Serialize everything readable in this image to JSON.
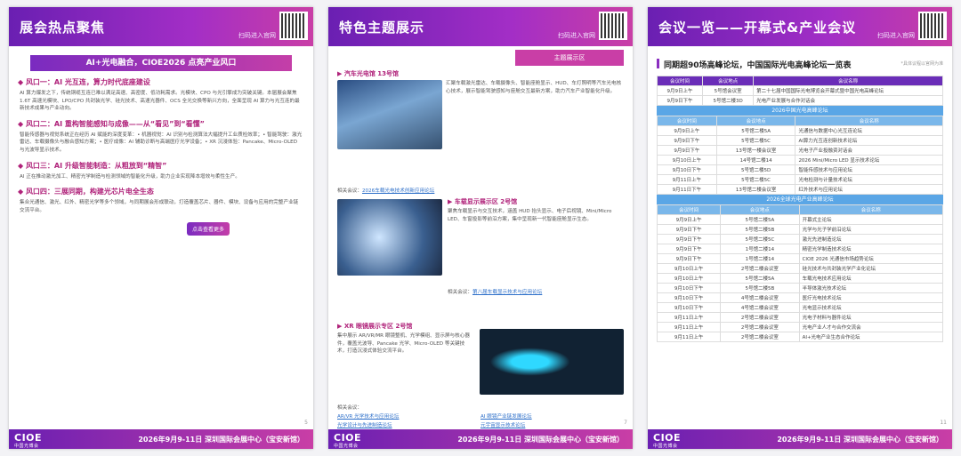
{
  "common": {
    "qr_label": "扫码进入官网",
    "logo": "CIOE",
    "logo_sub": "中国光博会",
    "footer": "2026年9月9-11日  深圳国际会展中心（宝安新馆）"
  },
  "page1": {
    "title": "展会热点聚焦",
    "banner": "AI+光电融合，CIOE2026 点亮产业风口",
    "sections": [
      {
        "title": "◆ 风口一：AI 光互连，算力时代底座建设",
        "text": "AI 算力爆发之下，传统铜缆互连已难以满足高速、高密度、低功耗需求。光模块、CPO 与光引擎成为突破关键。本届展会聚焦 1.6T 高速光模块、LPO/CPO 共封装光学、硅光技术、高速光器件、OCS 全光交换等新兴方向，全面呈现 AI 算力与光互连的最新技术成果与产业动向。"
      },
      {
        "title": "◆ 风口二：AI 重构智能感知与成像——从“看见”到“看懂”",
        "text": "智能传感器与视觉系统正在经历 AI 赋能的深度变革：• 机器视觉：AI 识别与检测算法大幅提升工业质检效率；• 智能驾驶：激光雷达、车载摄像头与融合感知方案；• 医疗成像：AI 辅助诊断与高端医疗光学设备；• XR 沉浸体验：Pancake、Micro-OLED 与光波导显示技术。"
      },
      {
        "title": "◆ 风口三：AI 升级智能制造：从粗放到“精智”",
        "text": "AI 正在推动激光加工、精密光学制造与检测领域的智能化升级，助力企业实现降本增效与柔性生产。"
      },
      {
        "title": "◆ 风口四：三展同期，构建光芯片电全生态",
        "text": "集合光通信、激光、红外、精密光学等多个领域，与同期展会形成联动，打造覆盖芯片、器件、模块、设备与应用的完整产业链交流平台。"
      }
    ],
    "button": "点击查看更多",
    "page_no": "5"
  },
  "page2": {
    "title": "特色主题展示",
    "tag": "主题展示区",
    "items": [
      {
        "title": "▶ 汽车光电馆 13号馆",
        "text": "汇聚车载激光雷达、车载摄像头、智能座舱显示、HUD、车灯照明等汽车光电核心技术，展示智能驾驶感知与座舱交互最新方案，助力汽车产业智能化升级。",
        "related": "相关会议：",
        "link": "2026车载光电技术创新应用论坛"
      },
      {
        "title": "▶ 车载显示展示区 2号馆",
        "text": "聚焦车载显示与交互技术，涵盖 HUD 抬头显示、电子后视镜、Mini/Micro LED、车窗投影等前沿方案，集中呈现新一代智能座舱显示生态。",
        "related": "相关会议：",
        "link": "第八届车载显示技术与应用论坛"
      },
      {
        "title": "▶ XR 眼镜展示专区 2号馆",
        "text": "集中展示 AR/VR/MR 眼镜整机、光学模组、显示屏与核心器件，覆盖光波导、Pancake 光学、Micro-OLED 等关键技术，打造沉浸式体验交流平台。",
        "related": "相关会议：",
        "links": [
          "AR/VR 光学技术与应用论坛",
          "AI 眼镜产业链发展论坛",
          "光学设计与先进制造论坛",
          "元宇宙显示技术论坛"
        ]
      }
    ],
    "page_no": "7"
  },
  "page3": {
    "title": "会议一览——开幕式&产业会议",
    "heading": "同期超90场高峰论坛，中国国际光电高峰论坛一览表",
    "note": "*具体议程以官网为准",
    "cols": [
      "会议时间",
      "会议地点",
      "会议名称"
    ],
    "opening": [
      [
        "9月9日上午",
        "5号馆会议室",
        "第二十七届中国国际光电博览会开幕式暨中国光电高峰论坛"
      ],
      [
        "9月9日下午",
        "5号馆二楼3D",
        "光电产业发展与合作对话会"
      ]
    ],
    "band1": "2026中国光电高峰论坛",
    "rows1": [
      [
        "9月9日上午",
        "5号馆二楼5A",
        "光通信与数据中心光互连论坛"
      ],
      [
        "9月9日下午",
        "5号馆二楼5C",
        "AI算力光互连创新技术论坛"
      ],
      [
        "9月9日下午",
        "13号馆一楼会议室",
        "光电子产业投融资对话会"
      ],
      [
        "9月10日上午",
        "14号馆二楼14",
        "2026 Mini/Micro LED 显示技术论坛"
      ],
      [
        "9月10日下午",
        "5号馆二楼5D",
        "智能传感技术与应用论坛"
      ],
      [
        "9月11日上午",
        "5号馆二楼5C",
        "光电检测与计量技术论坛"
      ],
      [
        "9月11日下午",
        "13号馆二楼会议室",
        "红外技术与应用论坛"
      ]
    ],
    "band2": "2026全球光电产业高峰论坛",
    "rows2": [
      [
        "9月9日上午",
        "5号馆二楼5A",
        "开幕式主论坛"
      ],
      [
        "9月9日下午",
        "5号馆二楼5B",
        "光学与光子学前沿论坛"
      ],
      [
        "9月9日下午",
        "5号馆二楼5C",
        "激光先进制造论坛"
      ],
      [
        "9月9日下午",
        "1号馆二楼14",
        "精密光学制造技术论坛"
      ],
      [
        "9月9日下午",
        "1号馆二楼14",
        "CIOE 2026 光通信市场趋势论坛"
      ],
      [
        "9月10日上午",
        "2号馆二楼会议室",
        "硅光技术与共封装光学产业化论坛"
      ],
      [
        "9月10日上午",
        "5号馆二楼5A",
        "车载光电技术应用论坛"
      ],
      [
        "9月10日下午",
        "5号馆二楼5B",
        "半导体激光技术论坛"
      ],
      [
        "9月10日下午",
        "4号馆二楼会议室",
        "医疗光电技术论坛"
      ],
      [
        "9月10日下午",
        "4号馆二楼会议室",
        "光电显示技术论坛"
      ],
      [
        "9月11日上午",
        "2号馆二楼会议室",
        "光电子材料与器件论坛"
      ],
      [
        "9月11日上午",
        "2号馆二楼会议室",
        "光电产业人才与合作交流会"
      ],
      [
        "9月11日上午",
        "2号馆二楼会议室",
        "AI+光电产业生态合作论坛"
      ]
    ],
    "page_no": "11"
  }
}
